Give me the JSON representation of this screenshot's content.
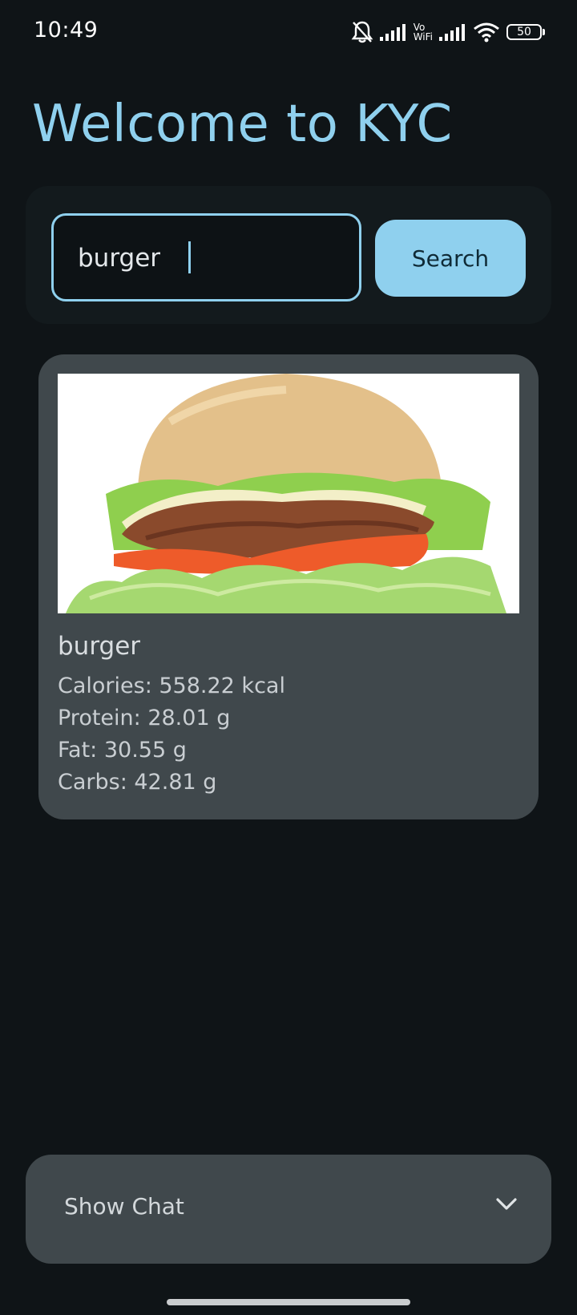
{
  "status_bar": {
    "time": "10:49",
    "network_label_top": "Vo",
    "network_label_bottom": "WiFi",
    "battery": "50",
    "icons": [
      "bell-off-icon",
      "signal-icon",
      "vowifi-icon",
      "signal-icon",
      "wifi-icon",
      "battery-icon"
    ]
  },
  "header": {
    "title": "Welcome to KYC"
  },
  "search": {
    "value": "burger",
    "button_label": "Search"
  },
  "result": {
    "image_icon": "burger-image",
    "name": "burger",
    "calories": "Calories: 558.22 kcal",
    "protein": "Protein: 28.01 g",
    "fat": "Fat: 30.55 g",
    "carbs": "Carbs: 42.81 g"
  },
  "chat": {
    "label": "Show Chat",
    "icon": "chevron-down-icon"
  },
  "colors": {
    "background": "#0f1417",
    "accent": "#8fd0ee",
    "card": "#40484c",
    "panel": "#131a1d"
  }
}
